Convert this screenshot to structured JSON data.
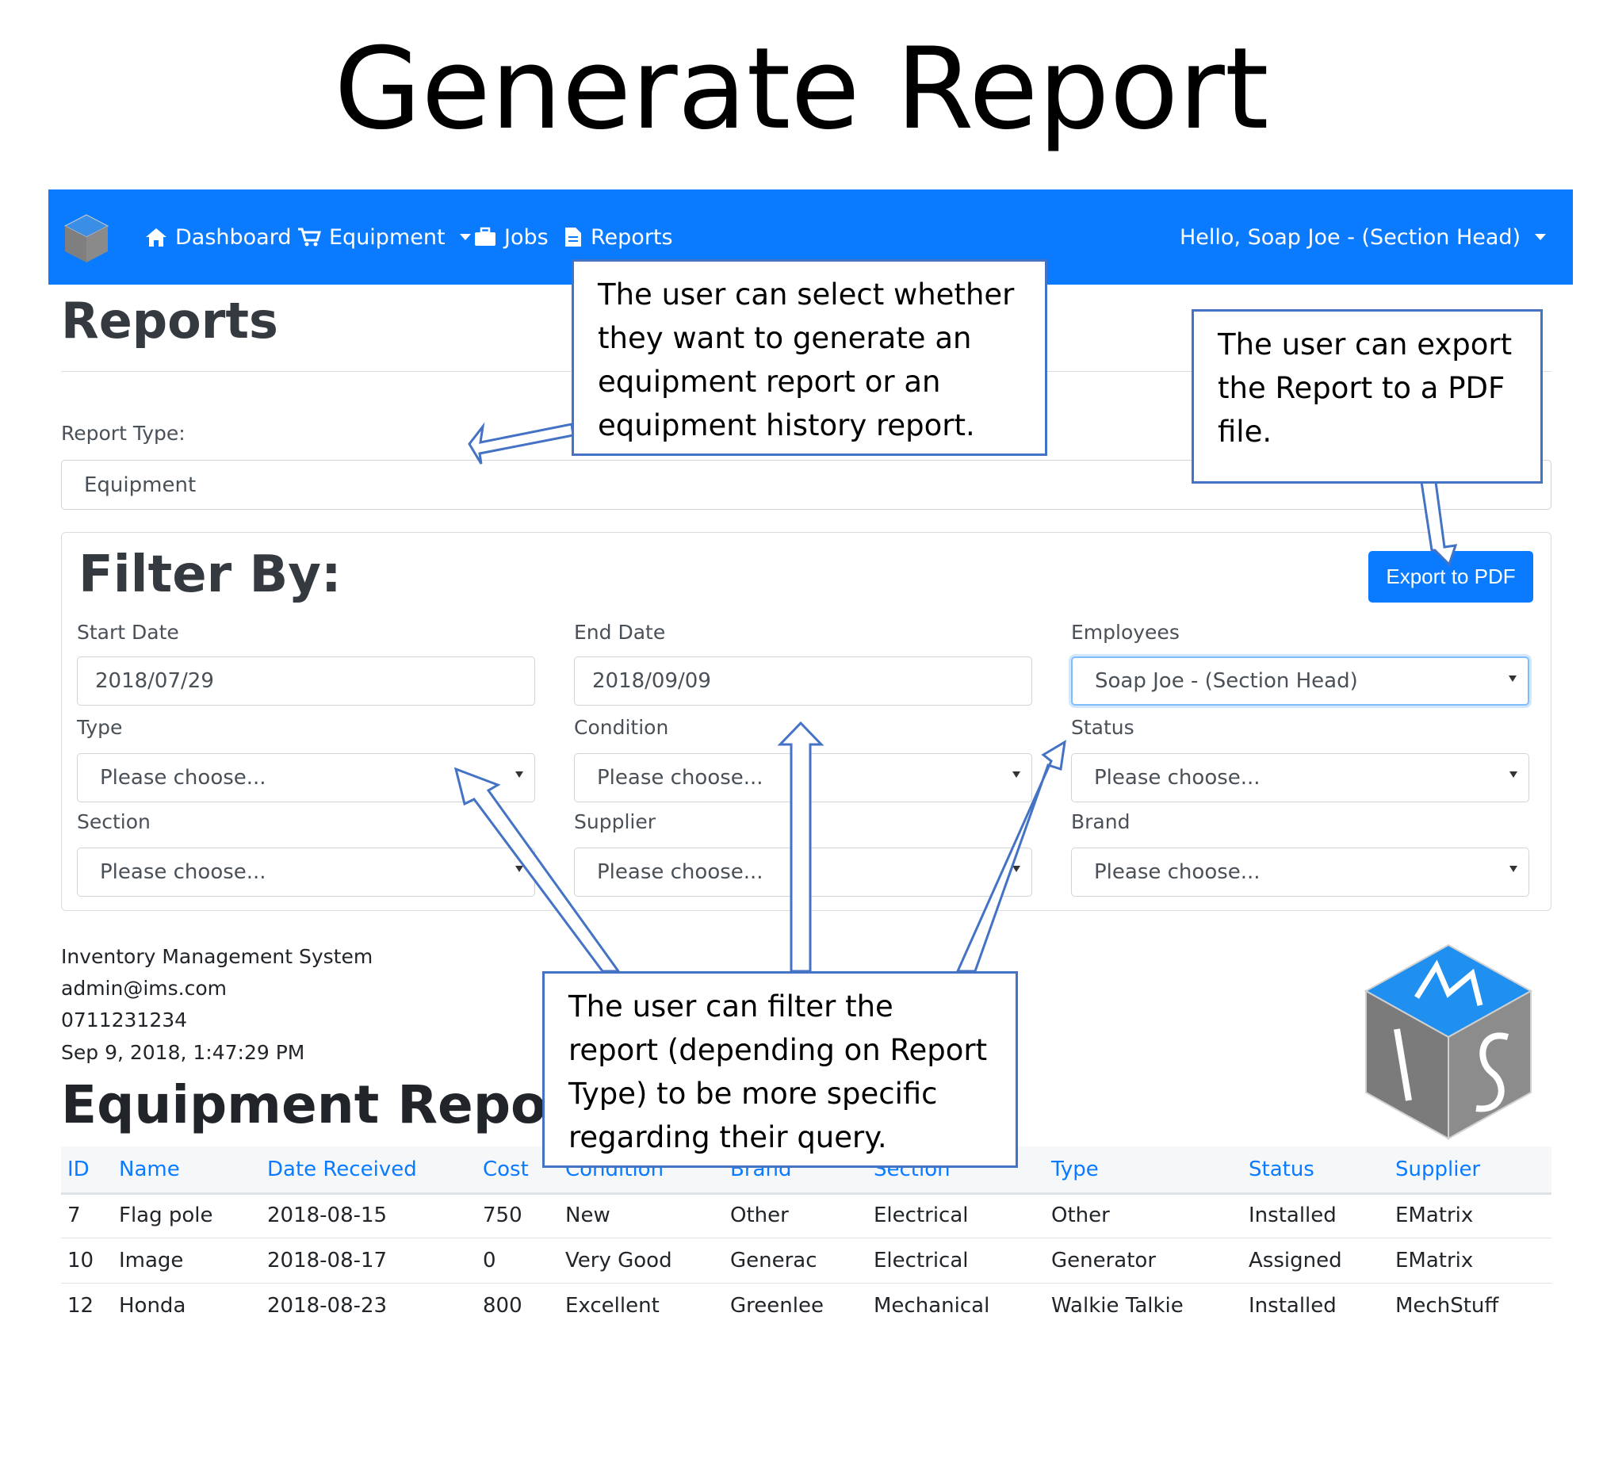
{
  "slide_title": "Generate Report",
  "navbar": {
    "logo_letters": "MIS",
    "items": [
      {
        "label": "Dashboard",
        "icon": "home-icon"
      },
      {
        "label": "Equipment",
        "icon": "cart-icon"
      },
      {
        "label": "Jobs",
        "icon": "briefcase-icon"
      },
      {
        "label": "Reports",
        "icon": "document-icon"
      }
    ],
    "user_menu": "Hello, Soap Joe - (Section Head)"
  },
  "page": {
    "heading": "Reports",
    "report_type_label": "Report Type:",
    "report_type_value": "Equipment",
    "filter_heading": "Filter By:",
    "export_button": "Export to PDF",
    "filters": {
      "start_date": {
        "label": "Start Date",
        "value": "2018/07/29"
      },
      "end_date": {
        "label": "End Date",
        "value": "2018/09/09"
      },
      "employees": {
        "label": "Employees",
        "value": "Soap Joe - (Section Head)"
      },
      "type": {
        "label": "Type",
        "value": "Please choose..."
      },
      "condition": {
        "label": "Condition",
        "value": "Please choose..."
      },
      "status": {
        "label": "Status",
        "value": "Please choose..."
      },
      "section": {
        "label": "Section",
        "value": "Please choose..."
      },
      "supplier": {
        "label": "Supplier",
        "value": "Please choose..."
      },
      "brand": {
        "label": "Brand",
        "value": "Please choose..."
      }
    },
    "company": {
      "name": "Inventory Management System",
      "email": "admin@ims.com",
      "phone": "0711231234",
      "timestamp": "Sep 9, 2018, 1:47:29 PM"
    },
    "report_heading": "Equipment Report",
    "table": {
      "columns": [
        "ID",
        "Name",
        "Date Received",
        "Cost",
        "Condition",
        "Brand",
        "Section",
        "Type",
        "Status",
        "Supplier"
      ],
      "rows": [
        [
          "7",
          "Flag pole",
          "2018-08-15",
          "750",
          "New",
          "Other",
          "Electrical",
          "Other",
          "Installed",
          "EMatrix"
        ],
        [
          "10",
          "Image",
          "2018-08-17",
          "0",
          "Very Good",
          "Generac",
          "Electrical",
          "Generator",
          "Assigned",
          "EMatrix"
        ],
        [
          "12",
          "Honda",
          "2018-08-23",
          "800",
          "Excellent",
          "Greenlee",
          "Mechanical",
          "Walkie Talkie",
          "Installed",
          "MechStuff"
        ]
      ]
    }
  },
  "callouts": {
    "report_type": "The user can select whether they want to generate an equipment report or an equipment history report.",
    "export": "The user can export the Report to a PDF file.",
    "filter": "The user can filter the report (depending on Report Type) to be more specific regarding their query."
  },
  "colors": {
    "primary": "#0a7bff",
    "callout_border": "#4472c4"
  }
}
